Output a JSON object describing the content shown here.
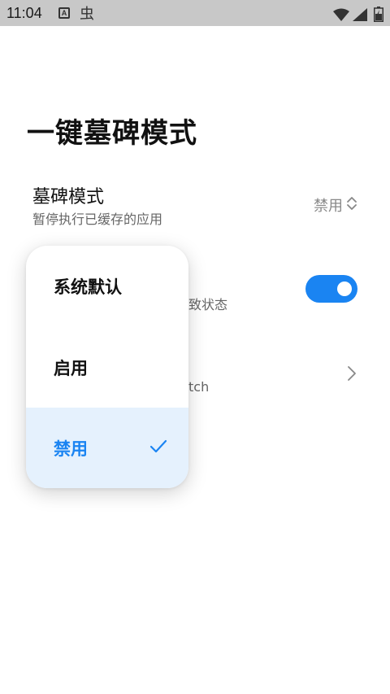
{
  "status_bar": {
    "time": "11:04",
    "notification_a": "A",
    "notification_bug": "虫",
    "icons": [
      "wifi-icon",
      "signal-icon",
      "battery-icon"
    ]
  },
  "page": {
    "title": "一键墓碑模式"
  },
  "settings": {
    "tombstone_mode": {
      "title": "墓碑模式",
      "subtitle": "暂停执行已缓存的应用",
      "value": "禁用"
    },
    "row2_partial_subtitle": "级致状态",
    "row2_toggle_on": true,
    "row3_partial_subtitle": "tch"
  },
  "dropdown": {
    "options": [
      "系统默认",
      "启用",
      "禁用"
    ],
    "selected": "禁用"
  },
  "colors": {
    "accent": "#1a84f2",
    "selected_bg": "#e5f1fd",
    "status_bar_bg": "#c8c8c8"
  }
}
